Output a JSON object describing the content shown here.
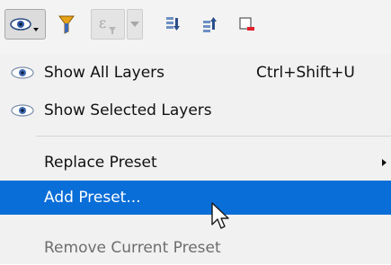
{
  "toolbar": {
    "buttons": [
      {
        "icon": "eye-dropdown-icon",
        "state": "pressed"
      },
      {
        "icon": "filter-icon"
      },
      {
        "icon": "expression-filter-icon",
        "state": "disabled"
      },
      {
        "icon": "chevron-down-icon",
        "state": "disabled"
      },
      {
        "icon": "expand-all-icon"
      },
      {
        "icon": "collapse-all-icon"
      },
      {
        "icon": "remove-layer-icon"
      }
    ]
  },
  "menu": {
    "items": [
      {
        "label": "Show All Layers",
        "shortcut": "Ctrl+Shift+U",
        "icon": "eye-icon"
      },
      {
        "label": "Show Selected Layers",
        "icon": "eye-icon"
      },
      {
        "label": "Replace Preset",
        "submenu": true
      },
      {
        "label": "Add Preset...",
        "state": "highlighted"
      },
      {
        "label": "Remove Current Preset",
        "state": "disabled"
      }
    ]
  },
  "colors": {
    "highlight": "#0a6ed8",
    "toolbar_bg": "#f3f3f3",
    "menu_bg": "#f1f1f1",
    "disabled_text": "#6d6d6d"
  }
}
